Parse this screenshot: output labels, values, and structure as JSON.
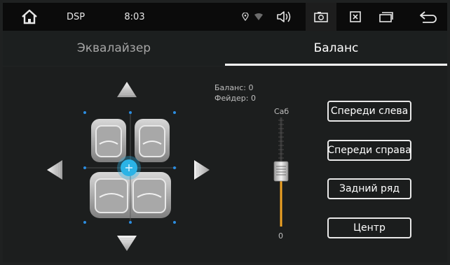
{
  "statusbar": {
    "home_icon": "home-icon",
    "mode_label": "DSP",
    "time": "8:03",
    "icons": [
      "location-icon",
      "wifi-icon",
      "volume-icon",
      "screenshot-icon",
      "close-box-icon",
      "window-icon",
      "back-icon"
    ]
  },
  "tabs": [
    {
      "label": "Эквалайзер",
      "active": false
    },
    {
      "label": "Баланс",
      "active": true
    }
  ],
  "balance": {
    "balance_text": "Баланс: 0",
    "fader_text": "Фейдер: 0"
  },
  "subwoofer": {
    "label": "Саб",
    "value": "0",
    "level": 0.5
  },
  "presets": [
    {
      "label": "Спереди слева"
    },
    {
      "label": "Спереди справа"
    },
    {
      "label": "Задний ряд"
    },
    {
      "label": "Центр"
    }
  ],
  "colors": {
    "accent": "#2bb3e6",
    "slider_fill": "#f0a323",
    "handle_dots": "#2b8de0"
  }
}
